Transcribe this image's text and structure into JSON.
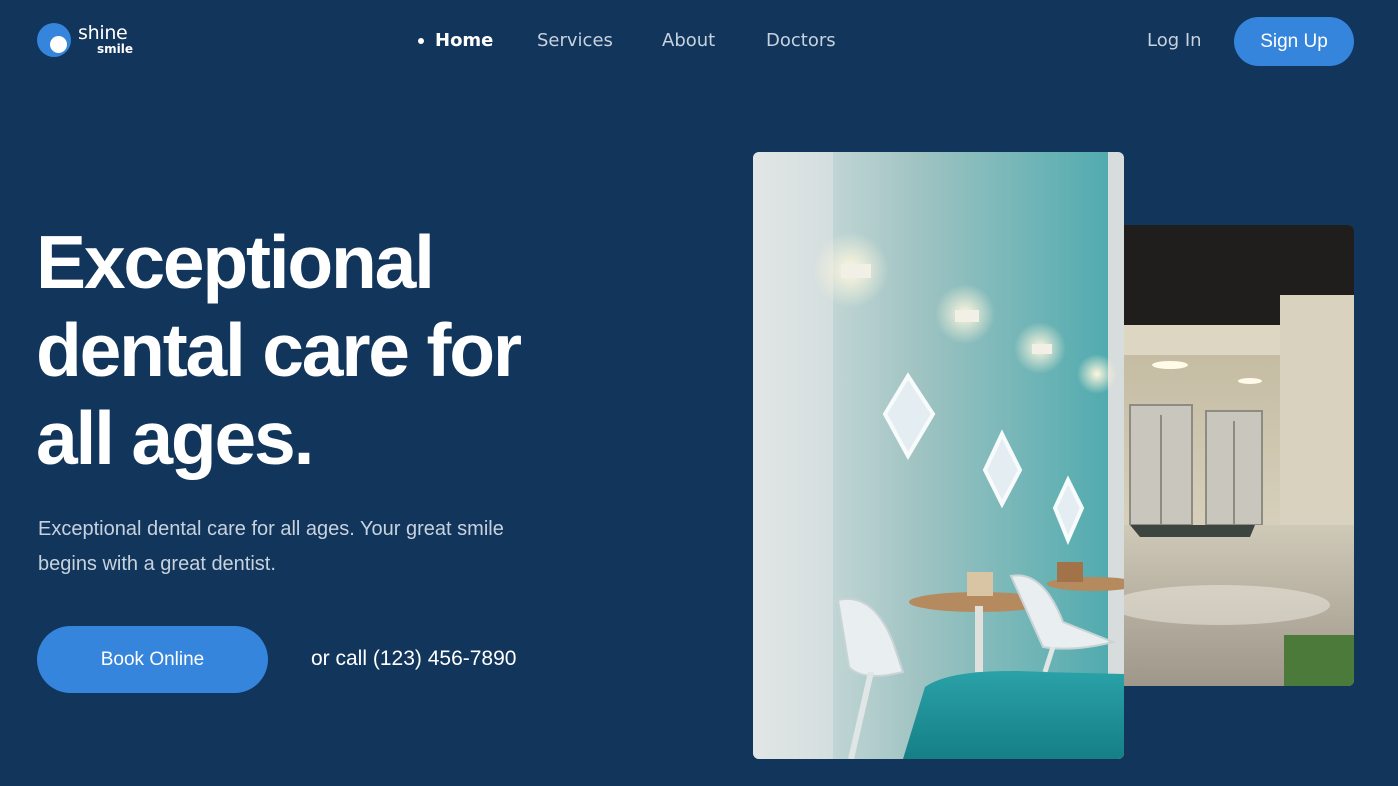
{
  "brand": {
    "name_primary": "shine",
    "name_secondary": "smile",
    "accent_color": "#3585dc",
    "background_color": "#12355b"
  },
  "nav": {
    "items": [
      {
        "label": "Home",
        "active": true
      },
      {
        "label": "Services",
        "active": false
      },
      {
        "label": "About",
        "active": false
      },
      {
        "label": "Doctors",
        "active": false
      }
    ]
  },
  "auth": {
    "login_label": "Log In",
    "signup_label": "Sign Up"
  },
  "hero": {
    "headline_line1": "Exceptional",
    "headline_line2": "dental care for",
    "headline_line3": "all ages.",
    "subtext_line1": "Exceptional dental care for all ages. Your great smile",
    "subtext_line2": "begins with a great dentist.",
    "book_label": "Book Online",
    "call_text": "or call (123) 456-7890"
  },
  "images": {
    "front_icon": "clinic-waiting-room-photo",
    "back_icon": "clinic-hallway-elevators-photo"
  }
}
